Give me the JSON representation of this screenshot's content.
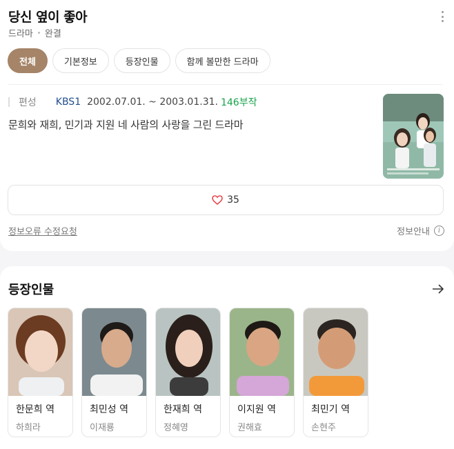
{
  "header": {
    "title": "당신 옆이 좋아",
    "genre": "드라마",
    "status": "완결"
  },
  "tabs": [
    {
      "label": "전체",
      "active": true
    },
    {
      "label": "기본정보",
      "active": false
    },
    {
      "label": "등장인물",
      "active": false
    },
    {
      "label": "함께 볼만한 드라마",
      "active": false
    }
  ],
  "info": {
    "label": "편성",
    "network": "KBS1",
    "dates": "2002.07.01. ~ 2003.01.31.",
    "episodes": "146부작",
    "description": "문희와 재희, 민기과 지원 네 사람의 사랑을 그린 드라마",
    "poster_text": "당신 옆이 좋아"
  },
  "like": {
    "count": "35",
    "icon": "heart-icon"
  },
  "footer": {
    "report_label": "정보오류 수정요청",
    "guide_label": "정보안내",
    "guide_icon": "info-icon"
  },
  "cast": {
    "title": "등장인물",
    "arrow_icon": "arrow-right-icon",
    "members": [
      {
        "role": "한문희 역",
        "actor": "하희라"
      },
      {
        "role": "최민성 역",
        "actor": "이재룡"
      },
      {
        "role": "한재희 역",
        "actor": "정혜영"
      },
      {
        "role": "이지원 역",
        "actor": "권해효"
      },
      {
        "role": "최민기 역",
        "actor": "손현주"
      }
    ]
  },
  "colors": {
    "accent": "#a58468",
    "network": "#1f4e8c",
    "episodes": "#17a34a",
    "heart": "#e5484d"
  }
}
